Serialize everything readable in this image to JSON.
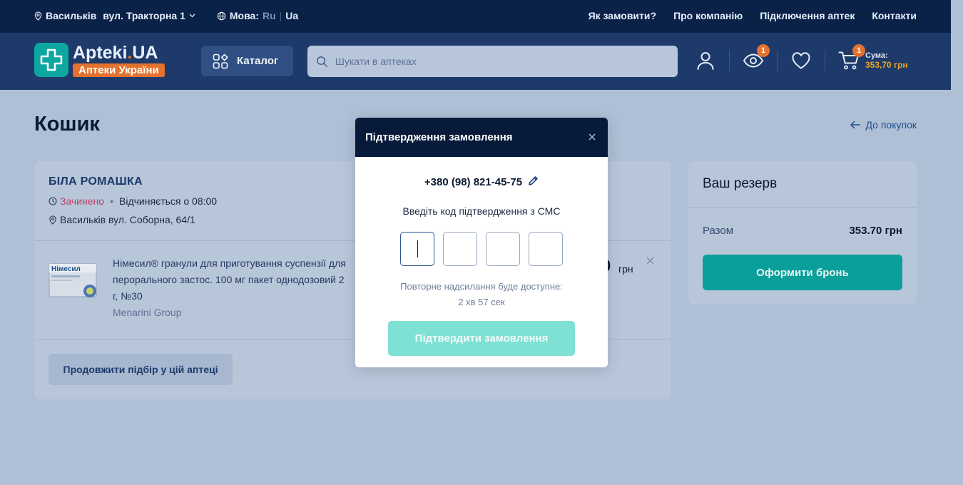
{
  "topbar": {
    "city": "Васильків",
    "address": "вул. Тракторна 1",
    "lang_label": "Мова:",
    "lang_ru": "Ru",
    "lang_ua": "Ua",
    "links": [
      "Як замовити?",
      "Про компанію",
      "Підключення аптек",
      "Контакти"
    ]
  },
  "header": {
    "logo_title_a": "Apteki",
    "logo_title_b": ".UA",
    "logo_sub": "Аптеки України",
    "catalog": "Каталог",
    "search_placeholder": "Шукати в аптеках",
    "viewed_count": "1",
    "cart_count": "1",
    "sum_label": "Сума:",
    "sum_value": "353,70 грн"
  },
  "page": {
    "title": "Кошик",
    "back": "До покупок"
  },
  "pharmacy": {
    "name": "БІЛА РОМАШКА",
    "status": "Зачинено",
    "opens": "Відчиняється о 08:00",
    "address": "Васильків вул. Соборна, 64/1",
    "continue": "Продовжити підбір у цій аптеці"
  },
  "product": {
    "name": "Німесил® гранули для приготування суспензії для перорального застос. 100 мг пакет однодозовий 2 г, №30",
    "maker": "Menarini Group",
    "price_tail": "0",
    "currency": "грн",
    "box_label": "Німесил"
  },
  "reserve": {
    "title": "Ваш резерв",
    "total_label": "Разом",
    "total_value": "353.70 грн",
    "button": "Оформити бронь"
  },
  "modal": {
    "title": "Підтвердження замовлення",
    "phone": "+380 (98) 821-45-75",
    "instruction": "Введіть код підтвердження з СМС",
    "resend_line1": "Повторне надсилання буде доступне:",
    "resend_line2": "2 хв 57 сек",
    "confirm": "Підтвердити замовлення"
  },
  "colors": {
    "accent": "#0a9f9b",
    "navy": "#081a3a",
    "orange": "#e4722f"
  }
}
